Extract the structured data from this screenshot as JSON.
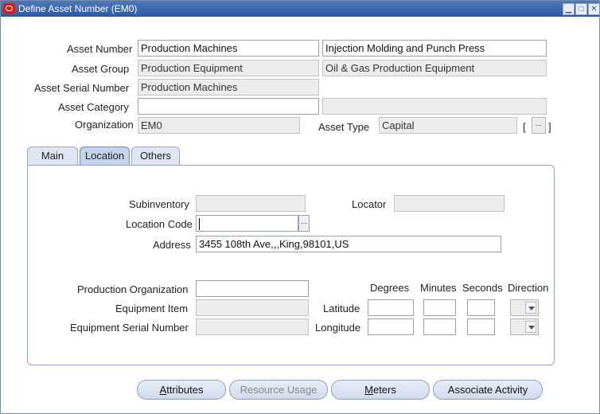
{
  "window": {
    "title": "Define Asset Number (EM0)"
  },
  "header": {
    "asset_number_label": "Asset Number",
    "asset_number_value": "Production Machines",
    "asset_description_value": "Injection Molding and Punch Press",
    "asset_group_label": "Asset Group",
    "asset_group_value": "Production Equipment",
    "asset_group_desc_value": "Oil & Gas Production Equipment",
    "asset_serial_label": "Asset Serial Number",
    "asset_serial_value": "Production Machines",
    "asset_category_label": "Asset Category",
    "asset_category_value": "",
    "asset_category_desc_value": "",
    "organization_label": "Organization",
    "organization_value": "EM0",
    "asset_type_label": "Asset Type",
    "asset_type_value": "Capital",
    "bracket_open": "[",
    "bracket_close": "]",
    "dots_label": "..."
  },
  "tabs": [
    {
      "label": "Main",
      "active": false
    },
    {
      "label": "Location",
      "active": true
    },
    {
      "label": "Others",
      "active": false
    }
  ],
  "location": {
    "subinventory_label": "Subinventory",
    "subinventory_value": "",
    "locator_label": "Locator",
    "locator_value": "",
    "location_code_label": "Location Code",
    "location_code_value": "",
    "location_dots": "...",
    "address_label": "Address",
    "address_value": "3455 108th Ave,,,King,98101,US",
    "production_org_label": "Production Organization",
    "production_org_value": "",
    "equipment_item_label": "Equipment Item",
    "equipment_item_value": "",
    "equipment_serial_label": "Equipment Serial Number",
    "equipment_serial_value": "",
    "degrees_header": "Degrees",
    "minutes_header": "Minutes",
    "seconds_header": "Seconds",
    "direction_header": "Direction",
    "latitude_label": "Latitude",
    "longitude_label": "Longitude"
  },
  "buttons": {
    "attributes": "Attributes",
    "resource_usage": "Resource Usage",
    "meters": "Meters",
    "associate_activity": "Associate Activity"
  },
  "colors": {
    "title_bar": "#2f5a9e",
    "active_tab": "#c4d3ea",
    "readonly_field": "#ececec"
  }
}
